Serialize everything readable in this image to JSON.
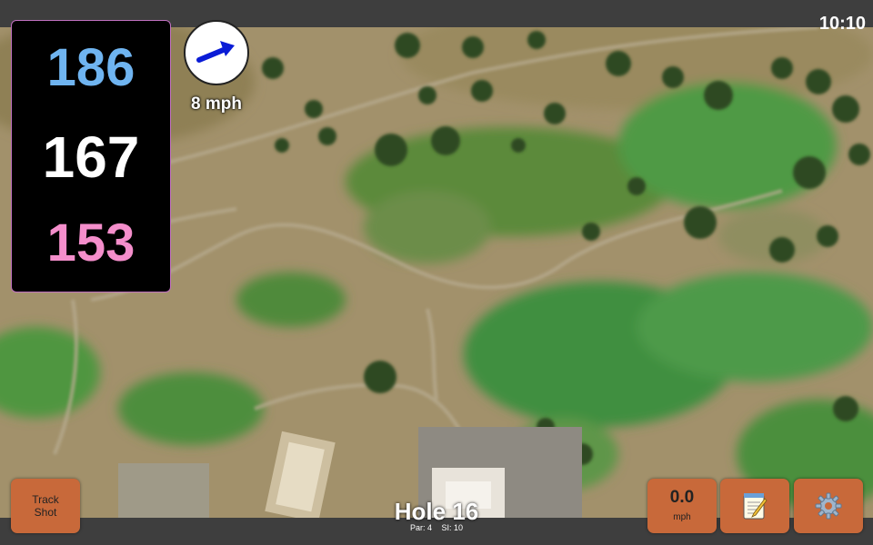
{
  "status": {
    "clock": "10:10"
  },
  "yardages": {
    "back": "186",
    "middle": "167",
    "front": "153",
    "colors": {
      "back": "#6fb4f0",
      "middle": "#ffffff",
      "front": "#f48ecb"
    }
  },
  "wind": {
    "speed": "8 mph",
    "arrow_color": "#0a1cd6"
  },
  "buttons": {
    "track_shot_line1": "Track",
    "track_shot_line2": "Shot",
    "speed_value": "0.0",
    "speed_unit": "mph",
    "notes_icon": "notepad-icon",
    "settings_icon": "gear-icon"
  },
  "hole": {
    "title": "Hole 16",
    "par": "Par: 4",
    "si": "SI: 10"
  },
  "theme": {
    "button_color": "#c8693a",
    "panel_border": "#c070c0",
    "accent": "#a050c0"
  }
}
